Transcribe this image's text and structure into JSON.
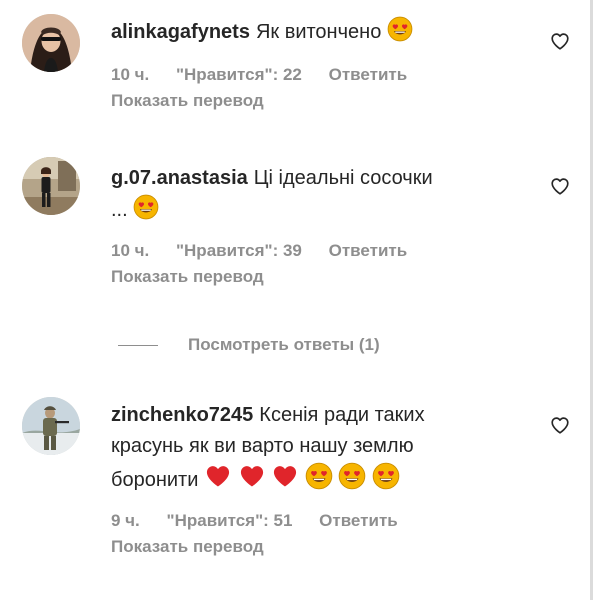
{
  "comments": [
    {
      "username": "alinkagafynets",
      "text_lines": [
        "Як витончено"
      ],
      "time": "10 ч.",
      "likes": "\"Нравится\": 22",
      "reply": "Ответить",
      "translate": "Показать перевод"
    },
    {
      "username": "g.07.anastasia",
      "text_lines": [
        "Ці ідеальні сосочки",
        "..."
      ],
      "time": "10 ч.",
      "likes": "\"Нравится\": 39",
      "reply": "Ответить",
      "translate": "Показать перевод"
    },
    {
      "username": "zinchenko7245",
      "text_lines": [
        "Ксенія ради таких",
        "красунь як ви варто нашу землю",
        "боронити"
      ],
      "time": "9 ч.",
      "likes": "\"Нравится\": 51",
      "reply": "Ответить",
      "translate": "Показать перевод"
    }
  ],
  "view_replies": "Посмотреть ответы (1)",
  "icons": {
    "like": "heart-outline-icon",
    "emoji_heart_eyes": "heart-eyes-emoji",
    "emoji_red_heart": "red-heart-emoji"
  },
  "colors": {
    "text": "#262626",
    "secondary": "#8e8e8e",
    "emoji_face": "#f7b500",
    "emoji_heart": "#e0252b"
  }
}
